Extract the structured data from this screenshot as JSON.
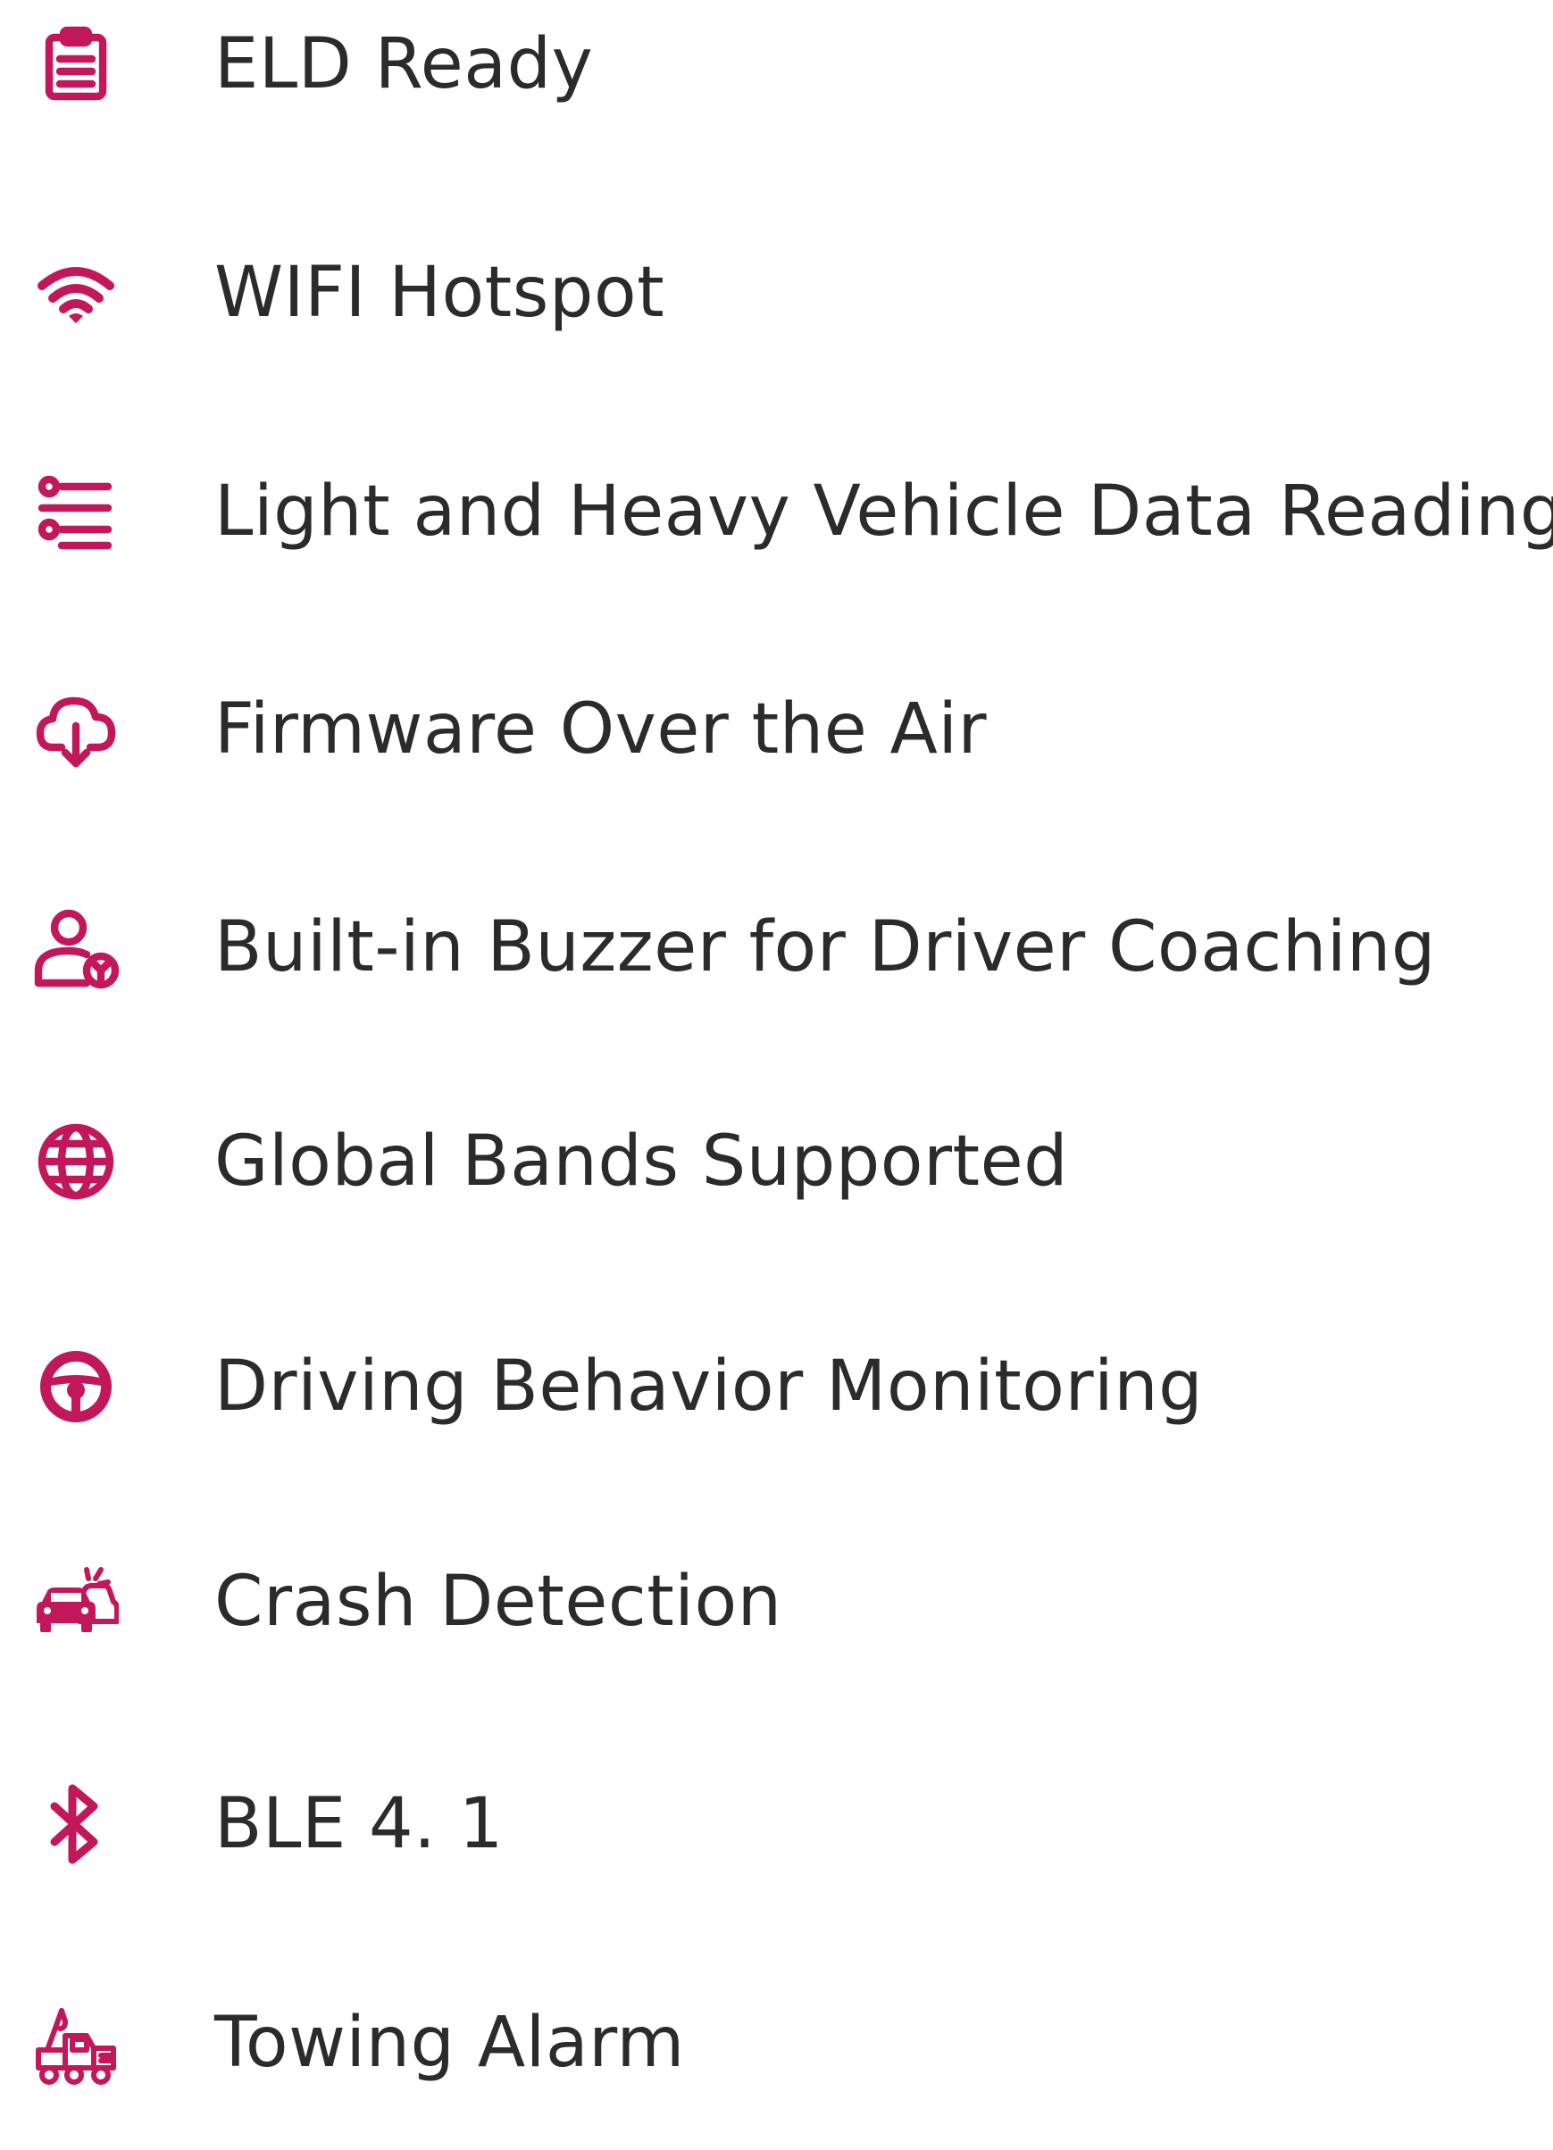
{
  "theme": {
    "accent_color": "#c2185b",
    "text_color": "#2b2b2b",
    "background_color": "#ffffff"
  },
  "features": [
    {
      "label": "ELD Ready",
      "icon": "clipboard-icon"
    },
    {
      "label": "WIFI Hotspot",
      "icon": "wifi-icon"
    },
    {
      "label": "Light and Heavy Vehicle Data Reading",
      "icon": "list-settings-icon"
    },
    {
      "label": "Firmware Over the Air",
      "icon": "cloud-download-icon"
    },
    {
      "label": "Built-in Buzzer for Driver Coaching",
      "icon": "driver-coaching-icon"
    },
    {
      "label": "Global Bands Supported",
      "icon": "globe-icon"
    },
    {
      "label": "Driving Behavior Monitoring",
      "icon": "steering-wheel-icon"
    },
    {
      "label": "Crash Detection",
      "icon": "car-crash-icon"
    },
    {
      "label": "BLE 4. 1",
      "icon": "bluetooth-icon"
    },
    {
      "label": "Towing Alarm",
      "icon": "tow-truck-icon"
    }
  ]
}
